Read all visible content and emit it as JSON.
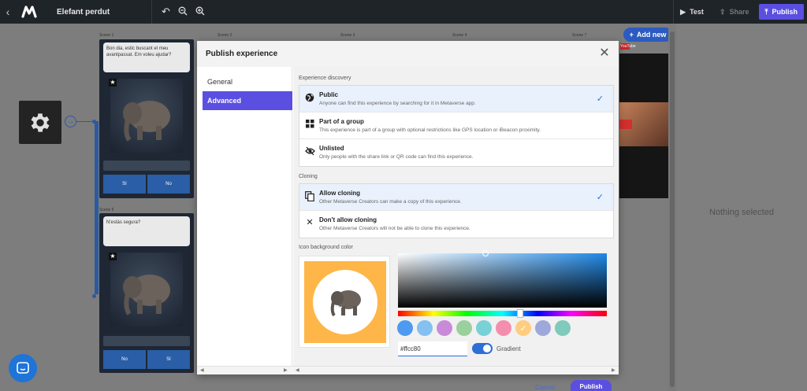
{
  "topbar": {
    "title": "Elefant perdut",
    "test_label": "Test",
    "share_label": "Share",
    "publish_label": "Publish"
  },
  "canvas": {
    "scene_labels": [
      "Scene 1",
      "Scene 2",
      "Scene 3",
      "Scene 4",
      "Scene 7",
      "Scene 5"
    ],
    "scene1": {
      "bubble": "Bon dia, estic buscant el meu avantpassat. Em voleu ajudar?",
      "choices": [
        "Sí",
        "No"
      ]
    },
    "scene5": {
      "bubble": "N'estàs segura?",
      "choices": [
        "No",
        "Sí"
      ]
    },
    "add_new_label": "Add new",
    "yt_badge": "YouTube"
  },
  "right_panel": {
    "empty_text": "Nothing selected"
  },
  "modal": {
    "title": "Publish experience",
    "sidebar": [
      {
        "label": "General",
        "active": false
      },
      {
        "label": "Advanced",
        "active": true
      }
    ],
    "discovery_label": "Experience discovery",
    "discovery_options": [
      {
        "icon": "globe-icon",
        "title": "Public",
        "desc": "Anyone can find this experience by searching for it in Metaverse app.",
        "selected": true
      },
      {
        "icon": "grid-icon",
        "title": "Part of a group",
        "desc": "This experience is part of a group with optional restrictions like GPS location or iBeacon proximity.",
        "selected": false
      },
      {
        "icon": "eye-off-icon",
        "title": "Unlisted",
        "desc": "Only people with the share link or QR code can find this experience.",
        "selected": false
      }
    ],
    "cloning_label": "Cloning",
    "cloning_options": [
      {
        "icon": "copy-icon",
        "title": "Allow cloning",
        "desc": "Other Metaverse Creators can make a copy of this experience.",
        "selected": true
      },
      {
        "icon": "close-icon",
        "title": "Don't allow cloning",
        "desc": "Other Metaverse Creators will not be able to clone this experience.",
        "selected": false
      }
    ],
    "icon_bg_label": "Icon background color",
    "hex_value": "#ffcc80",
    "gradient_label": "Gradient",
    "swatches": [
      "#4d9bf0",
      "#84c0f0",
      "#c98ad9",
      "#9ad09b",
      "#79d1d8",
      "#f38eaf",
      "#ffcc80",
      "#9fa8da",
      "#7fcabb"
    ],
    "selected_swatch": "#ffcc80",
    "cancel_label": "Cancel",
    "publish_label": "Publish"
  }
}
